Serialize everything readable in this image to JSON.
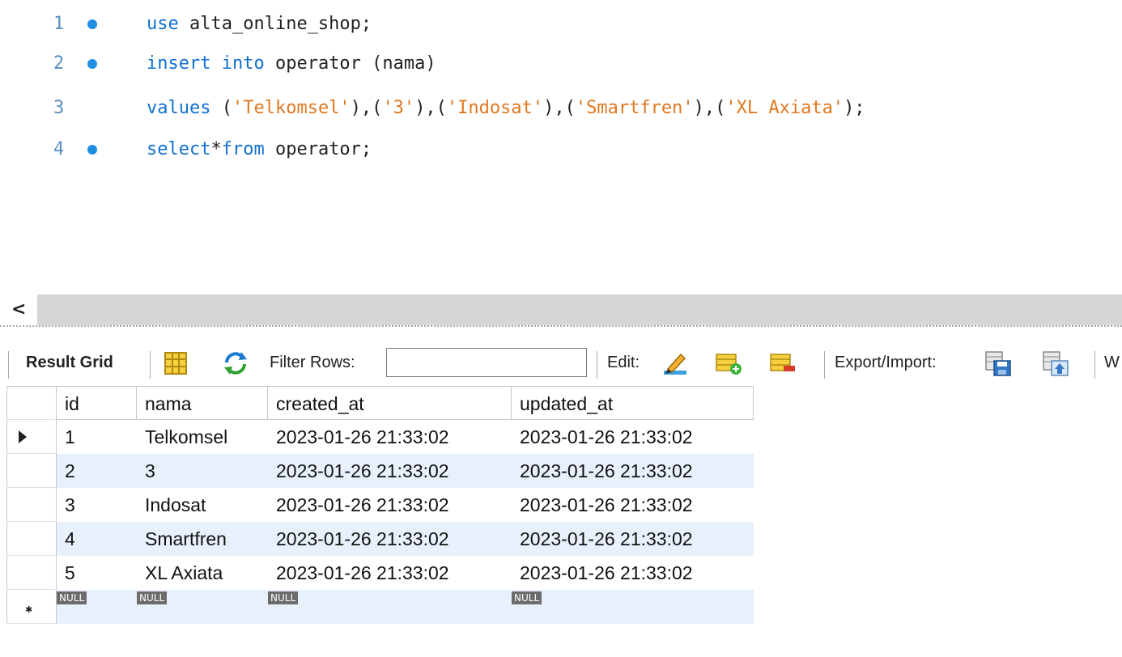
{
  "editor": {
    "lines": [
      {
        "num": "1",
        "dot": true,
        "tokens": [
          {
            "t": "use",
            "k": "kw"
          },
          {
            "t": " alta_online_shop;",
            "k": ""
          }
        ]
      },
      {
        "num": "2",
        "dot": true,
        "tokens": [
          {
            "t": "insert",
            "k": "kw"
          },
          {
            "t": " ",
            "k": ""
          },
          {
            "t": "into",
            "k": "kw"
          },
          {
            "t": " operator (nama)",
            "k": ""
          }
        ]
      },
      {
        "num": "3",
        "dot": false,
        "tokens": [
          {
            "t": "values",
            "k": "kw"
          },
          {
            "t": " (",
            "k": ""
          },
          {
            "t": "'Telkomsel'",
            "k": "str"
          },
          {
            "t": "),(",
            "k": ""
          },
          {
            "t": "'3'",
            "k": "str"
          },
          {
            "t": "),(",
            "k": ""
          },
          {
            "t": "'Indosat'",
            "k": "str"
          },
          {
            "t": "),(",
            "k": ""
          },
          {
            "t": "'Smartfren'",
            "k": "str"
          },
          {
            "t": "),(",
            "k": ""
          },
          {
            "t": "'XL Axiata'",
            "k": "str"
          },
          {
            "t": ");",
            "k": ""
          }
        ]
      },
      {
        "num": "4",
        "dot": true,
        "tokens": [
          {
            "t": "select",
            "k": "kw"
          },
          {
            "t": "*",
            "k": ""
          },
          {
            "t": "from",
            "k": "kw"
          },
          {
            "t": " operator;",
            "k": ""
          }
        ]
      }
    ]
  },
  "scrollbar": {
    "left_arrow": "<"
  },
  "toolbar": {
    "result_grid_label": "Result Grid",
    "filter_label": "Filter Rows:",
    "filter_value": "",
    "edit_label": "Edit:",
    "export_label": "Export/Import:",
    "wrap_label": "W"
  },
  "grid": {
    "columns": [
      "id",
      "nama",
      "created_at",
      "updated_at"
    ],
    "rows": [
      [
        "1",
        "Telkomsel",
        "2023-01-26 21:33:02",
        "2023-01-26 21:33:02"
      ],
      [
        "2",
        "3",
        "2023-01-26 21:33:02",
        "2023-01-26 21:33:02"
      ],
      [
        "3",
        "Indosat",
        "2023-01-26 21:33:02",
        "2023-01-26 21:33:02"
      ],
      [
        "4",
        "Smartfren",
        "2023-01-26 21:33:02",
        "2023-01-26 21:33:02"
      ],
      [
        "5",
        "XL Axiata",
        "2023-01-26 21:33:02",
        "2023-01-26 21:33:02"
      ]
    ],
    "null_label": "NULL"
  },
  "colors": {
    "keyword": "#1170d0",
    "string": "#e07820",
    "alt_row": "#e8f1fb"
  }
}
